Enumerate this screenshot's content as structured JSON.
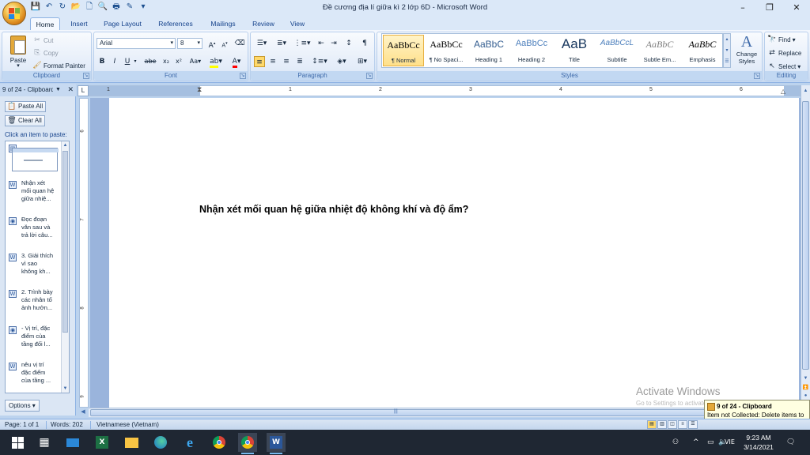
{
  "window": {
    "title": "Đề cương địa lí giữa kì 2 lớp 6D - Microsoft Word",
    "minimize": "–",
    "maximize": "❐",
    "close": "✕"
  },
  "qat": {
    "save_icon": "save-icon",
    "undo_icon": "undo-icon",
    "redo_icon": "redo-icon",
    "customize_icon": "customize-qat-icon"
  },
  "tabs": [
    "Home",
    "Insert",
    "Page Layout",
    "References",
    "Mailings",
    "Review",
    "View"
  ],
  "active_tab": "Home",
  "ribbon": {
    "clipboard": {
      "label": "Clipboard",
      "paste": "Paste",
      "cut": "Cut",
      "copy": "Copy",
      "format_painter": "Format Painter"
    },
    "font": {
      "label": "Font",
      "font_name": "Arial",
      "font_size": "8",
      "bold": "B",
      "italic": "I",
      "underline": "U",
      "strike": "abe",
      "subscript": "x₂",
      "superscript": "x²",
      "change_case": "Aa",
      "grow": "A",
      "shrink": "A",
      "highlight_color": "#ffff00",
      "font_color": "#ff0000"
    },
    "paragraph": {
      "label": "Paragraph"
    },
    "styles": {
      "label": "Styles",
      "items": [
        {
          "sample": "AaBbCc",
          "name": "¶ Normal",
          "selected": true
        },
        {
          "sample": "AaBbCc",
          "name": "¶ No Spaci..."
        },
        {
          "sample": "AaBbC",
          "name": "Heading 1"
        },
        {
          "sample": "AaBbCc",
          "name": "Heading 2"
        },
        {
          "sample": "AaB",
          "name": "Title"
        },
        {
          "sample": "AaBbCcL",
          "name": "Subtitle"
        },
        {
          "sample": "AaBbC",
          "name": "Subtle Em..."
        },
        {
          "sample": "AaBbC",
          "name": "Emphasis"
        }
      ],
      "change_styles": "Change Styles"
    },
    "editing": {
      "label": "Editing",
      "find": "Find",
      "replace": "Replace",
      "select": "Select"
    }
  },
  "clipboard_pane": {
    "title": "9 of 24 - Clipboard",
    "paste_all": "Paste All",
    "clear_all": "Clear All",
    "hint": "Click an item to paste:",
    "items": [
      {
        "lines": [
          "Nhận xét",
          "mối quan hệ",
          "giữa nhiệ..."
        ]
      },
      {
        "lines": [
          "Đọc đoạn",
          "văn sau và",
          "trả lời câu..."
        ]
      },
      {
        "lines": [
          "3. Giải thích",
          "vì sao",
          "không kh..."
        ]
      },
      {
        "lines": [
          "2. Trình bày",
          "các nhân tố",
          "ảnh hưởn..."
        ]
      },
      {
        "lines": [
          "- Vị trí, đặc",
          "điểm của",
          "tầng đối l..."
        ]
      },
      {
        "lines": [
          "nêu vị trí",
          "đặc điểm",
          "của tầng ..."
        ]
      }
    ],
    "options": "Options"
  },
  "ruler_numbers": [
    "1",
    "1",
    "2",
    "3",
    "4",
    "5",
    "6"
  ],
  "vruler_numbers": [
    "6",
    "7",
    "8",
    "9"
  ],
  "document": {
    "text": "Nhận xét mối quan hệ giữa nhiệt độ không khí và độ ẩm?"
  },
  "watermark": {
    "title": "Activate Windows",
    "sub": "Go to Settings to activate Windows."
  },
  "balloon": {
    "title": "9 of 24 - Clipboard",
    "text": "Item not Collected: Delete items to increase available space"
  },
  "status": {
    "page": "Page: 1 of 1",
    "words": "Words: 202",
    "language": "Vietnamese (Vietnam)"
  },
  "taskbar": {
    "language": "VIE",
    "time": "9:23 AM",
    "date": "3/14/2021"
  }
}
